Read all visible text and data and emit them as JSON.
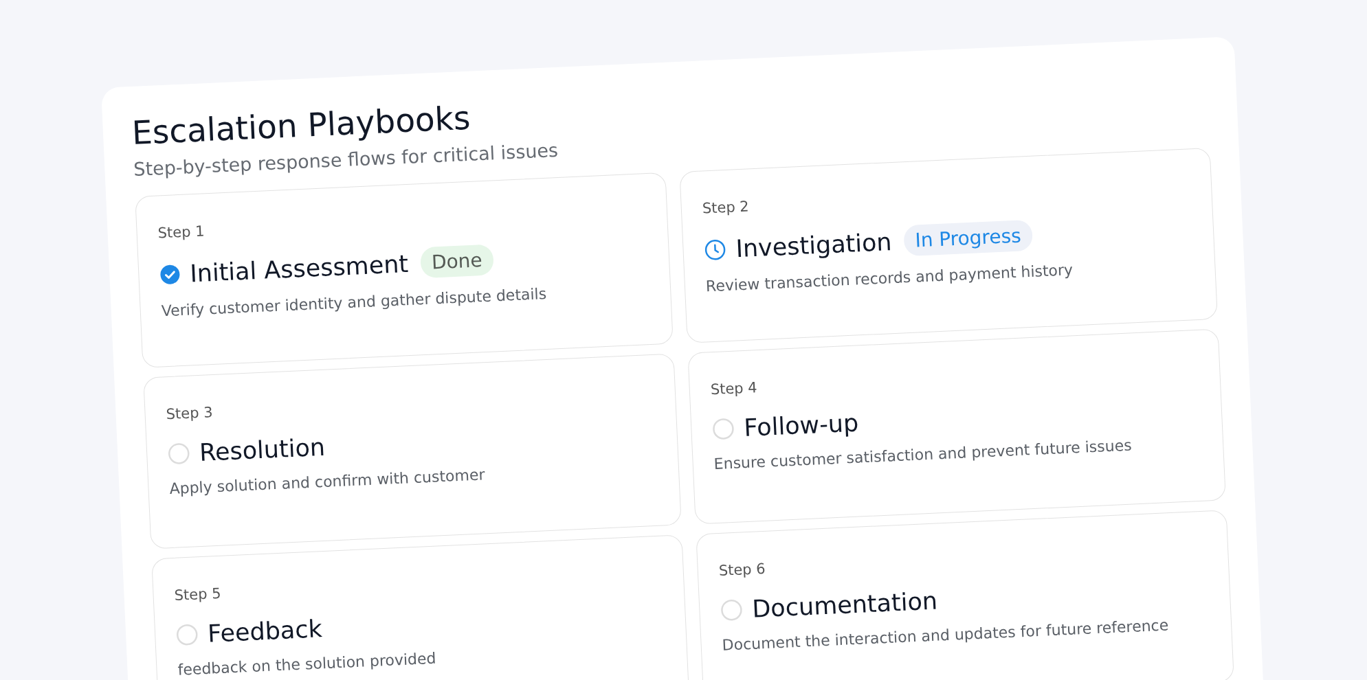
{
  "title": "Escalation Playbooks",
  "subtitle": "Step-by-step response flows for critical issues",
  "steps": [
    {
      "step": "Step 1",
      "title": "Initial Assessment",
      "kind": "done",
      "badge": {
        "label": "Done",
        "kind": "done"
      },
      "description": "Verify customer identity and gather dispute details"
    },
    {
      "step": "Step 2",
      "title": "Investigation",
      "kind": "in_progress",
      "badge": {
        "label": "In Progress",
        "kind": "in_progress"
      },
      "description": "Review transaction records and payment history"
    },
    {
      "step": "Step 3",
      "title": "Resolution",
      "kind": "pending",
      "description": "Apply solution and confirm with customer"
    },
    {
      "step": "Step 4",
      "title": "Follow-up",
      "kind": "pending",
      "description": "Ensure customer satisfaction and prevent future issues"
    },
    {
      "step": "Step 5",
      "title": "Feedback",
      "kind": "pending",
      "description": "feedback on the solution provided"
    },
    {
      "step": "Step 6",
      "title": "Documentation",
      "kind": "pending",
      "description": "Document the interaction and updates for future reference"
    }
  ]
}
